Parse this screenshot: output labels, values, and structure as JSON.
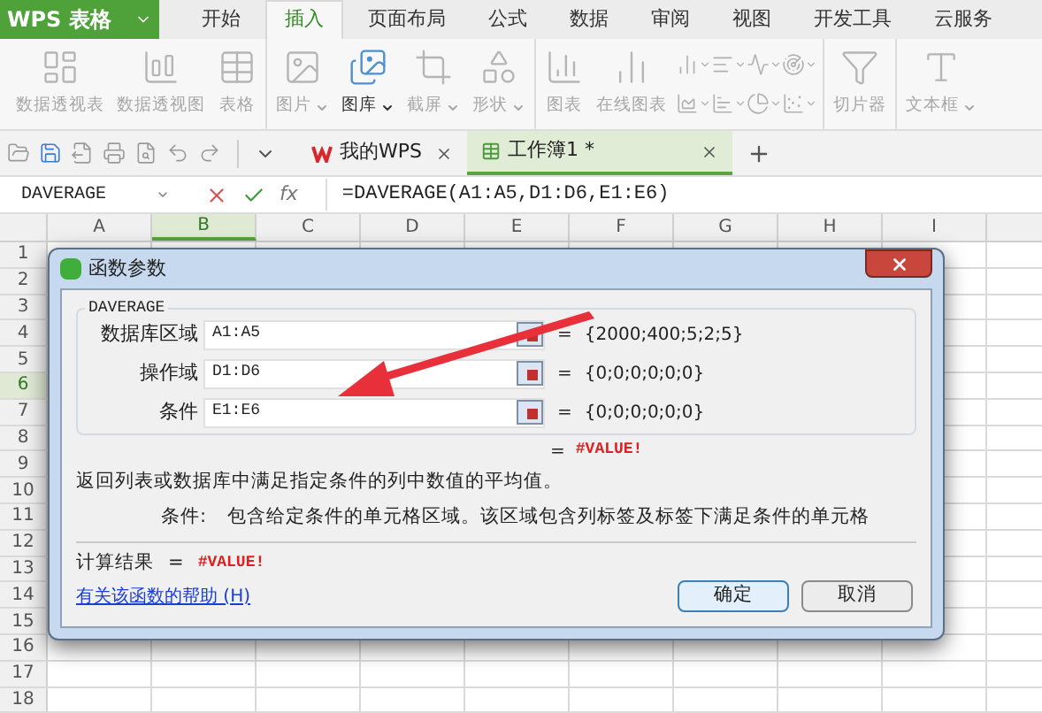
{
  "app_button": {
    "label": "WPS 表格"
  },
  "menu_tabs": [
    {
      "label": "开始",
      "selected": false
    },
    {
      "label": "插入",
      "selected": true
    },
    {
      "label": "页面布局",
      "selected": false
    },
    {
      "label": "公式",
      "selected": false
    },
    {
      "label": "数据",
      "selected": false
    },
    {
      "label": "审阅",
      "selected": false
    },
    {
      "label": "视图",
      "selected": false
    },
    {
      "label": "开发工具",
      "selected": false
    },
    {
      "label": "云服务",
      "selected": false
    }
  ],
  "ribbon": {
    "groups": [
      {
        "items": [
          {
            "kind": "large",
            "label": "数据透视表",
            "disabled": true,
            "dropdown": false
          },
          {
            "kind": "large",
            "label": "数据透视图",
            "disabled": true,
            "dropdown": false
          },
          {
            "kind": "large",
            "label": "表格",
            "disabled": true,
            "dropdown": false
          }
        ]
      },
      {
        "items": [
          {
            "kind": "large",
            "label": "图片",
            "disabled": true,
            "dropdown": true
          },
          {
            "kind": "large",
            "label": "图库",
            "disabled": false,
            "dropdown": true
          },
          {
            "kind": "large",
            "label": "截屏",
            "disabled": true,
            "dropdown": true
          },
          {
            "kind": "large",
            "label": "形状",
            "disabled": true,
            "dropdown": true
          }
        ]
      },
      {
        "items": [
          {
            "kind": "large",
            "label": "图表",
            "disabled": true,
            "dropdown": false
          },
          {
            "kind": "large",
            "label": "在线图表",
            "disabled": true,
            "dropdown": false
          },
          {
            "kind": "chart_grid"
          }
        ]
      },
      {
        "items": [
          {
            "kind": "large",
            "label": "切片器",
            "disabled": true,
            "dropdown": false
          }
        ]
      },
      {
        "items": [
          {
            "kind": "large",
            "label": "文本框",
            "disabled": true,
            "dropdown": true
          }
        ]
      }
    ]
  },
  "doc_tabs": [
    {
      "label": "我的WPS",
      "selected": false,
      "kind": "home"
    },
    {
      "label": "工作簿1 *",
      "selected": true,
      "kind": "sheet"
    }
  ],
  "formula_bar": {
    "name_box": "DAVERAGE",
    "fx": "fx",
    "formula": "=DAVERAGE(A1:A5,D1:D6,E1:E6)"
  },
  "sheet": {
    "columns": [
      {
        "label": "A",
        "selected": false
      },
      {
        "label": "B",
        "selected": true
      },
      {
        "label": "C",
        "selected": false
      },
      {
        "label": "D",
        "selected": false
      },
      {
        "label": "E",
        "selected": false
      },
      {
        "label": "F",
        "selected": false
      },
      {
        "label": "G",
        "selected": false
      },
      {
        "label": "H",
        "selected": false
      },
      {
        "label": "I",
        "selected": false
      }
    ],
    "rows": [
      {
        "label": "1",
        "selected": false
      },
      {
        "label": "2",
        "selected": false
      },
      {
        "label": "3",
        "selected": false
      },
      {
        "label": "4",
        "selected": false
      },
      {
        "label": "5",
        "selected": false
      },
      {
        "label": "6",
        "selected": true
      },
      {
        "label": "7",
        "selected": false
      },
      {
        "label": "8",
        "selected": false
      },
      {
        "label": "9",
        "selected": false
      },
      {
        "label": "10",
        "selected": false
      },
      {
        "label": "11",
        "selected": false
      },
      {
        "label": "12",
        "selected": false
      },
      {
        "label": "13",
        "selected": false
      },
      {
        "label": "14",
        "selected": false
      },
      {
        "label": "15",
        "selected": false
      },
      {
        "label": "16",
        "selected": false
      },
      {
        "label": "17",
        "selected": false
      },
      {
        "label": "18",
        "selected": false
      }
    ]
  },
  "dialog": {
    "title": "函数参数",
    "function_name": "DAVERAGE",
    "arguments": [
      {
        "label": "数据库区域",
        "value": "A1:A5",
        "equals": "=",
        "result": "{2000;400;5;2;5}"
      },
      {
        "label": "操作域",
        "value": "D1:D6",
        "equals": "=",
        "result": "{0;0;0;0;0;0}"
      },
      {
        "label": "条件",
        "value": "E1:E6",
        "equals": "=",
        "result": "{0;0;0;0;0;0}"
      }
    ],
    "formula_result": {
      "equals": "=",
      "value": "#VALUE!"
    },
    "description": "返回列表或数据库中满足指定条件的列中数值的平均值。",
    "parameter": {
      "label": "条件:",
      "text": "包含给定条件的单元格区域。该区域包含列标签及标签下满足条件的单元格"
    },
    "calc_result": {
      "label": "计算结果",
      "equals": "=",
      "value": "#VALUE!"
    },
    "help_link": "有关该函数的帮助 (H)",
    "buttons": [
      {
        "label": "确定",
        "default": true
      },
      {
        "label": "取消",
        "default": false
      }
    ]
  }
}
